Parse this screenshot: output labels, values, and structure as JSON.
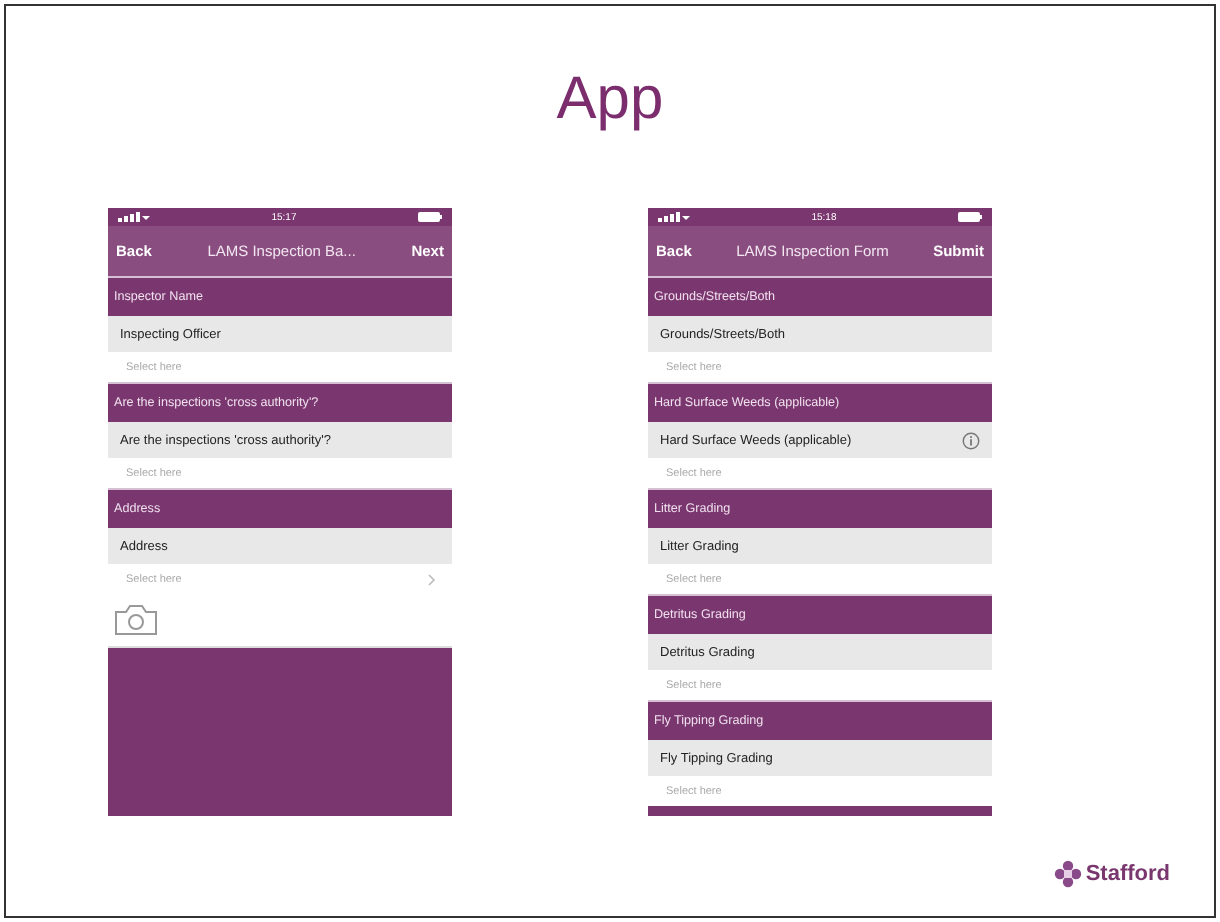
{
  "slide": {
    "title": "App",
    "logo": "Stafford"
  },
  "phones": [
    {
      "time": "15:17",
      "back": "Back",
      "title": "LAMS Inspection Ba...",
      "action": "Next",
      "camera": true,
      "sections": [
        {
          "header": "Inspector Name",
          "field": "Inspecting Officer",
          "placeholder": "Select here",
          "info": false,
          "chevron": false
        },
        {
          "header": "Are the inspections 'cross authority'?",
          "field": "Are the inspections 'cross authority'?",
          "placeholder": "Select here",
          "info": false,
          "chevron": false
        },
        {
          "header": "Address",
          "field": "Address",
          "placeholder": "Select here",
          "info": false,
          "chevron": true
        }
      ]
    },
    {
      "time": "15:18",
      "back": "Back",
      "title": "LAMS Inspection Form",
      "action": "Submit",
      "camera": false,
      "sections": [
        {
          "header": "Grounds/Streets/Both",
          "field": "Grounds/Streets/Both",
          "placeholder": "Select here",
          "info": false,
          "chevron": false
        },
        {
          "header": "Hard Surface Weeds (applicable)",
          "field": "Hard Surface Weeds (applicable)",
          "placeholder": "Select here",
          "info": true,
          "chevron": false
        },
        {
          "header": "Litter Grading",
          "field": "Litter Grading",
          "placeholder": "Select here",
          "info": false,
          "chevron": false
        },
        {
          "header": "Detritus Grading",
          "field": "Detritus Grading",
          "placeholder": "Select here",
          "info": false,
          "chevron": false
        },
        {
          "header": "Fly Tipping Grading",
          "field": "Fly Tipping Grading",
          "placeholder": "Select here",
          "info": false,
          "chevron": false
        }
      ]
    }
  ]
}
